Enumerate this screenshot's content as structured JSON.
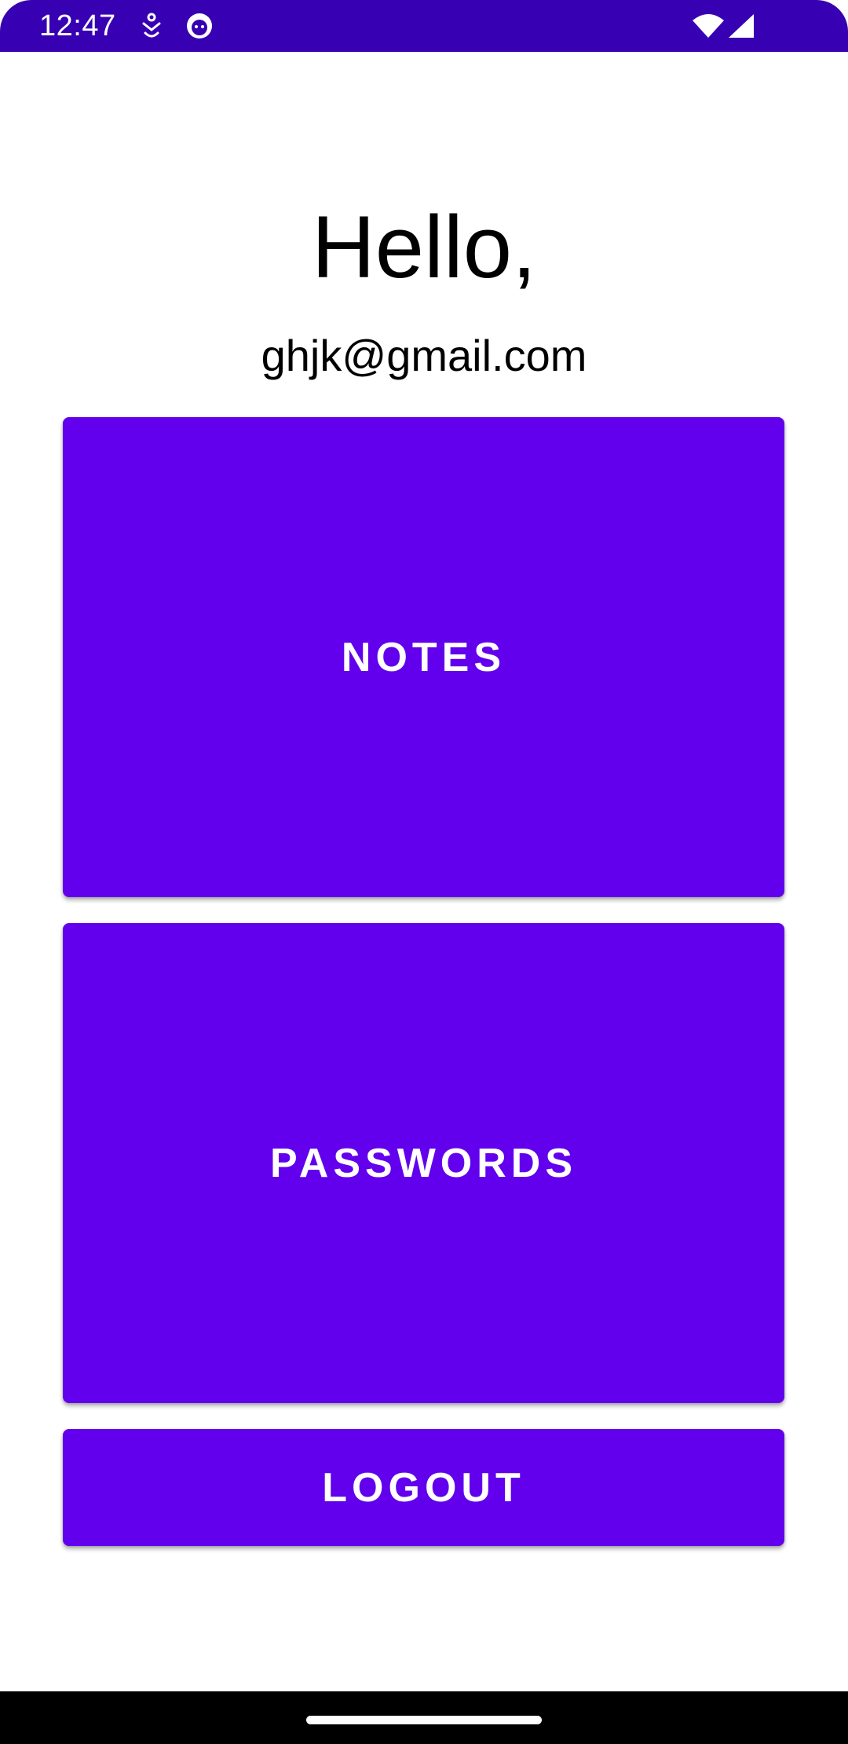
{
  "status_bar": {
    "time": "12:47",
    "background_color": "#3700b3",
    "icons": [
      "notification-accessibility-icon",
      "notification-app-icon",
      "wifi-icon",
      "cellular-signal-icon"
    ]
  },
  "main": {
    "greeting": "Hello,",
    "email": "ghjk@gmail.com"
  },
  "buttons": {
    "notes_label": "NOTES",
    "passwords_label": "PASSWORDS",
    "logout_label": "LOGOUT",
    "color": "#6200ee"
  },
  "nav_bar": {
    "background_color": "#000000"
  }
}
